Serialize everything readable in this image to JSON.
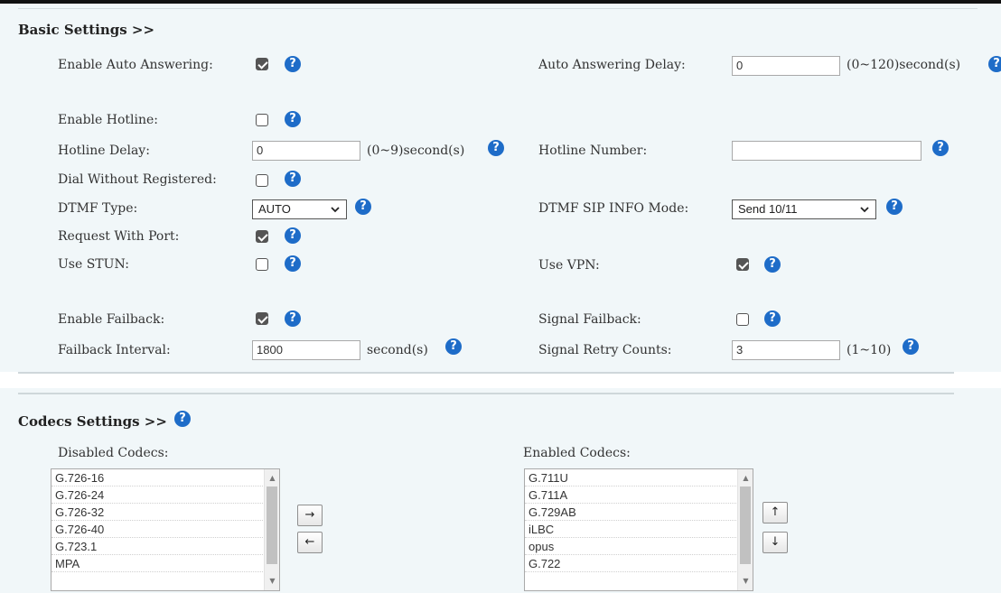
{
  "basic": {
    "header": "Basic Settings >>",
    "auto_answer": {
      "label": "Enable Auto Answering:",
      "checked": true
    },
    "auto_answer_delay": {
      "label": "Auto Answering Delay:",
      "value": "0",
      "unit": "(0~120)second(s)"
    },
    "hotline": {
      "label": "Enable Hotline:",
      "checked": false
    },
    "hotline_delay": {
      "label": "Hotline Delay:",
      "value": "0",
      "unit": "(0~9)second(s)"
    },
    "hotline_number": {
      "label": "Hotline Number:",
      "value": ""
    },
    "dial_without_registered": {
      "label": "Dial Without Registered:",
      "checked": false
    },
    "dtmf_type": {
      "label": "DTMF Type:",
      "value": "AUTO"
    },
    "dtmf_sip_info_mode": {
      "label": "DTMF SIP INFO Mode:",
      "value": "Send 10/11"
    },
    "request_with_port": {
      "label": "Request With Port:",
      "checked": true
    },
    "use_stun": {
      "label": "Use STUN:",
      "checked": false
    },
    "use_vpn": {
      "label": "Use VPN:",
      "checked": true
    },
    "enable_failback": {
      "label": "Enable Failback:",
      "checked": true
    },
    "signal_failback": {
      "label": "Signal Failback:",
      "checked": false
    },
    "failback_interval": {
      "label": "Failback Interval:",
      "value": "1800",
      "unit": "second(s)"
    },
    "signal_retry_counts": {
      "label": "Signal Retry Counts:",
      "value": "3",
      "unit": "(1~10)"
    }
  },
  "codecs": {
    "header": "Codecs Settings >>",
    "disabled_label": "Disabled Codecs:",
    "enabled_label": "Enabled Codecs:",
    "disabled": [
      "G.726-16",
      "G.726-24",
      "G.726-32",
      "G.726-40",
      "G.723.1",
      "MPA"
    ],
    "enabled": [
      "G.711U",
      "G.711A",
      "G.729AB",
      "iLBC",
      "opus",
      "G.722"
    ],
    "move_right": "→",
    "move_left": "←",
    "move_up": "↑",
    "move_down": "↓"
  },
  "icons": {
    "help": "?",
    "scroll_up": "▲",
    "scroll_down": "▼"
  },
  "colors": {
    "panel_bg": "#f1f7f9",
    "help_icon": "#1e6cc8",
    "checkbox_checked": "#555555"
  }
}
